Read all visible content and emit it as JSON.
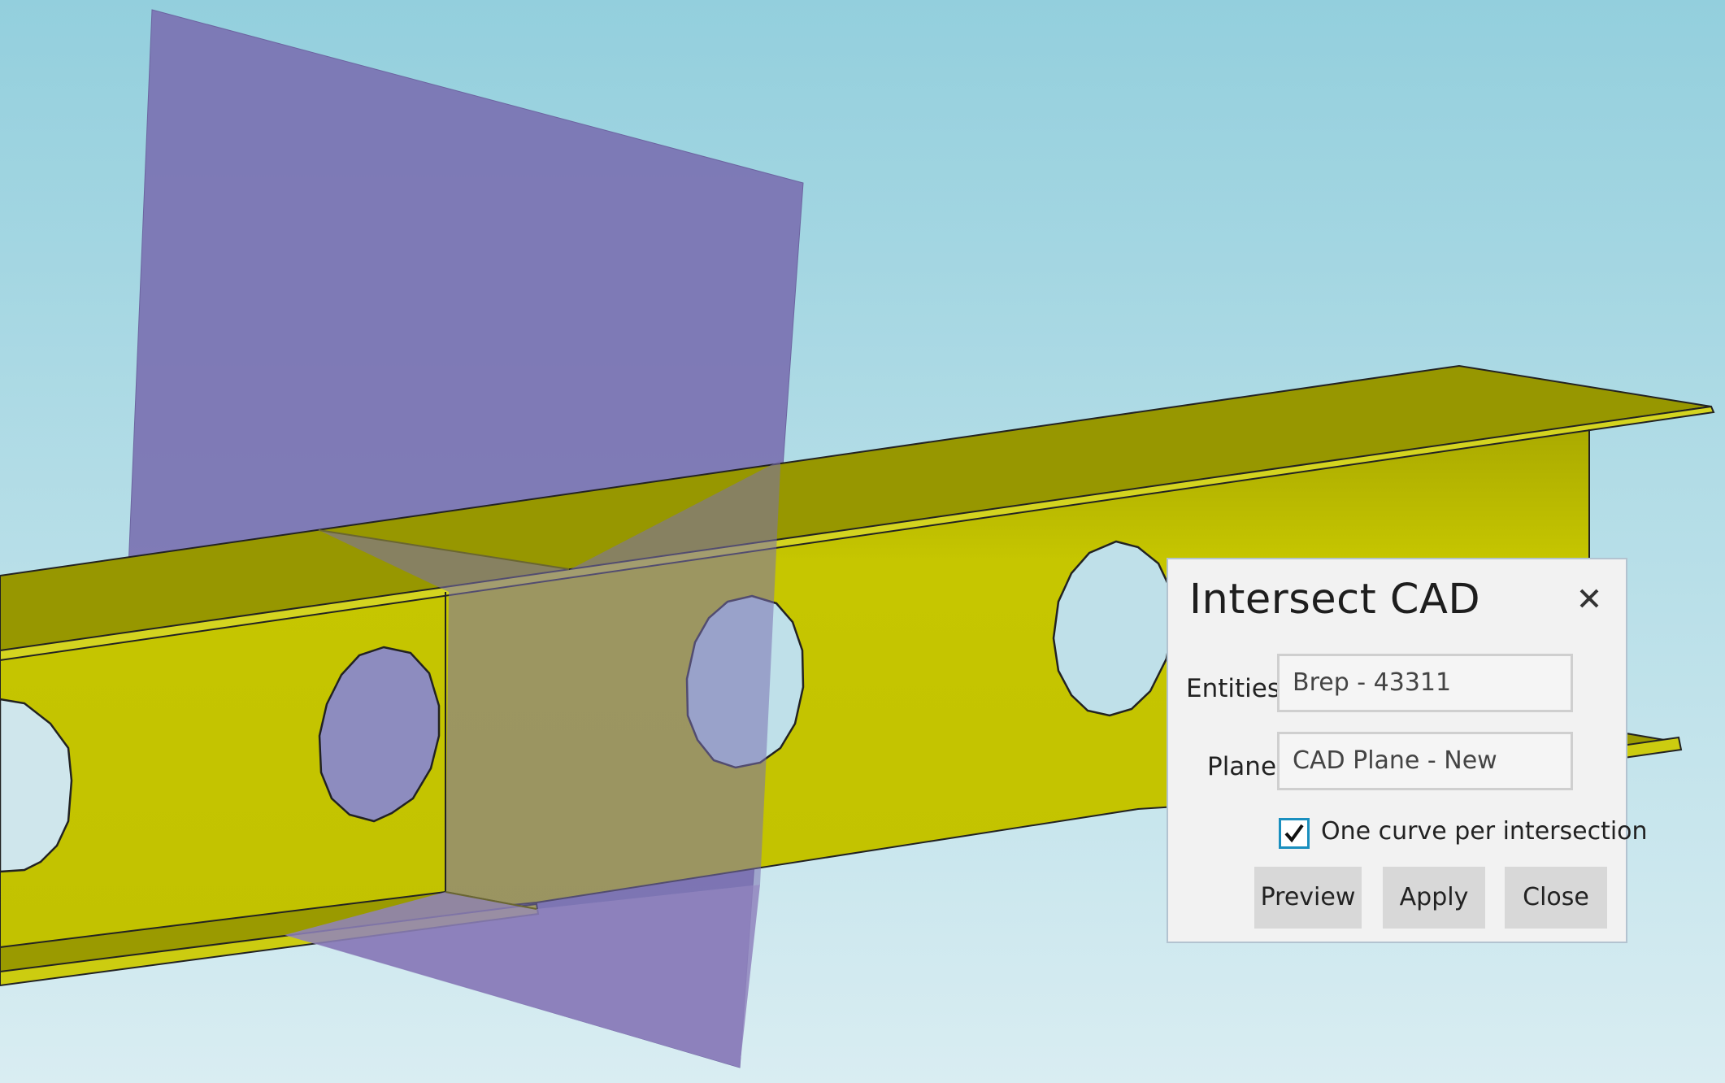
{
  "dialog": {
    "title": "Intersect CAD",
    "close_icon": "close-icon",
    "fields": {
      "entities_label": "Entities",
      "entities_value": "Brep - 43311",
      "plane_label": "Plane",
      "plane_value": "CAD Plane - New"
    },
    "checkbox": {
      "label": "One curve per intersection",
      "checked": true
    },
    "buttons": {
      "preview": "Preview",
      "apply": "Apply",
      "close": "Close"
    }
  },
  "colors": {
    "background_top": "#93cfdd",
    "background_bottom": "#d8edf2",
    "beam_web": "#c4c400",
    "beam_flange_top": "#979700",
    "plane": "#7b6fb5",
    "accent": "#1a8fbf"
  }
}
